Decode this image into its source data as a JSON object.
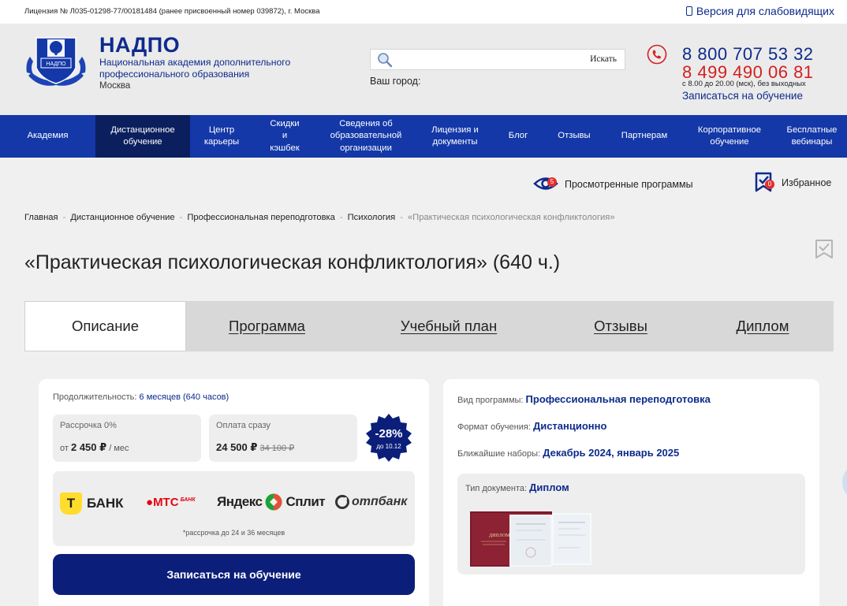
{
  "topbar": {
    "license": "Лицензия № Л035-01298-77/00181484 (ранее присвоенный номер 039872), г. Москва",
    "accessible_label": "Версия для слабовидящих"
  },
  "header": {
    "brand_name": "НАДПО",
    "brand_subtitle": "Национальная академия дополнительного профессионального образования",
    "brand_city": "Москва",
    "logo_label": "НАДПО",
    "search_placeholder": "",
    "search_button": "Искать",
    "city_label": "Ваш город:",
    "phone1": "8 800 707 53 32",
    "phone2": "8 499 490 06 81",
    "hours": "с 8.00 до 20.00 (мск), без выходных",
    "enroll_link": "Записаться на обучение"
  },
  "nav": {
    "items": [
      {
        "label": "Академия",
        "width": 121,
        "active": false
      },
      {
        "label": "Дистанционное обучение",
        "width": 120,
        "active": true
      },
      {
        "label": "Центр карьеры",
        "width": 80,
        "active": false
      },
      {
        "label": "Скидки и кэшбек",
        "width": 80,
        "active": false
      },
      {
        "label": "Сведения об образовательной организации",
        "width": 126,
        "active": false
      },
      {
        "label": "Лицензия и документы",
        "width": 100,
        "active": false
      },
      {
        "label": "Блог",
        "width": 60,
        "active": false
      },
      {
        "label": "Отзывы",
        "width": 82,
        "active": false
      },
      {
        "label": "Партнерам",
        "width": 96,
        "active": false
      },
      {
        "label": "Корпоративное обучение",
        "width": 120,
        "active": false
      },
      {
        "label": "Бесплатные вебинары",
        "width": 89,
        "active": false
      }
    ]
  },
  "watched": {
    "label": "Просмотренные программы",
    "count": "5"
  },
  "favorites": {
    "label": "Избранное",
    "count": "0"
  },
  "breadcrumb": {
    "items": [
      "Главная",
      "Дистанционное обучение",
      "Профессиональная переподготовка",
      "Психология"
    ],
    "current": "«Практическая психологическая конфликтология»"
  },
  "page_title": "«Практическая психологическая конфликтология» (640 ч.)",
  "tabs": [
    {
      "label": "Описание",
      "width": 205,
      "active": true
    },
    {
      "label": "Программа",
      "width": 205,
      "active": false
    },
    {
      "label": "Учебный план",
      "width": 256,
      "active": false
    },
    {
      "label": "Отзывы",
      "width": 180,
      "active": false
    },
    {
      "label": "Диплом",
      "width": 180,
      "active": false
    }
  ],
  "pricing": {
    "duration_label": "Продолжительность:",
    "duration_value": "6 месяцев (640 часов)",
    "installment_label": "Рассрочка 0%",
    "installment_prefix": "от",
    "installment_amount": "2 450 ₽",
    "installment_suffix": "/ мес",
    "full_label": "Оплата сразу",
    "full_price": "24 500 ₽",
    "old_price": "34 100 ₽",
    "discount": "-28%",
    "discount_until": "до 10.12",
    "banks": [
      "БАНК",
      "МТС",
      "БАНК",
      "Яндекс",
      "Сплит",
      "отпбанк"
    ],
    "banks_note": "*рассрочка до 24 и 36 месяцев",
    "enroll_button": "Записаться на обучение"
  },
  "program_info": {
    "type_label": "Вид программы:",
    "type_value": "Профессиональная переподготовка",
    "format_label": "Формат обучения:",
    "format_value": "Дистанционно",
    "intake_label": "Ближайшие наборы:",
    "intake_value": "Декабрь 2024, январь 2025",
    "doc_label": "Тип документа:",
    "doc_value": "Диплом",
    "diploma_cover_text": "ДИПЛОМ"
  },
  "colors": {
    "brand_blue": "#0d2b8c",
    "nav_blue": "#1438a8",
    "nav_active": "#0b1f5e",
    "phone_red": "#d42020",
    "button_navy": "#0b1e7a"
  }
}
